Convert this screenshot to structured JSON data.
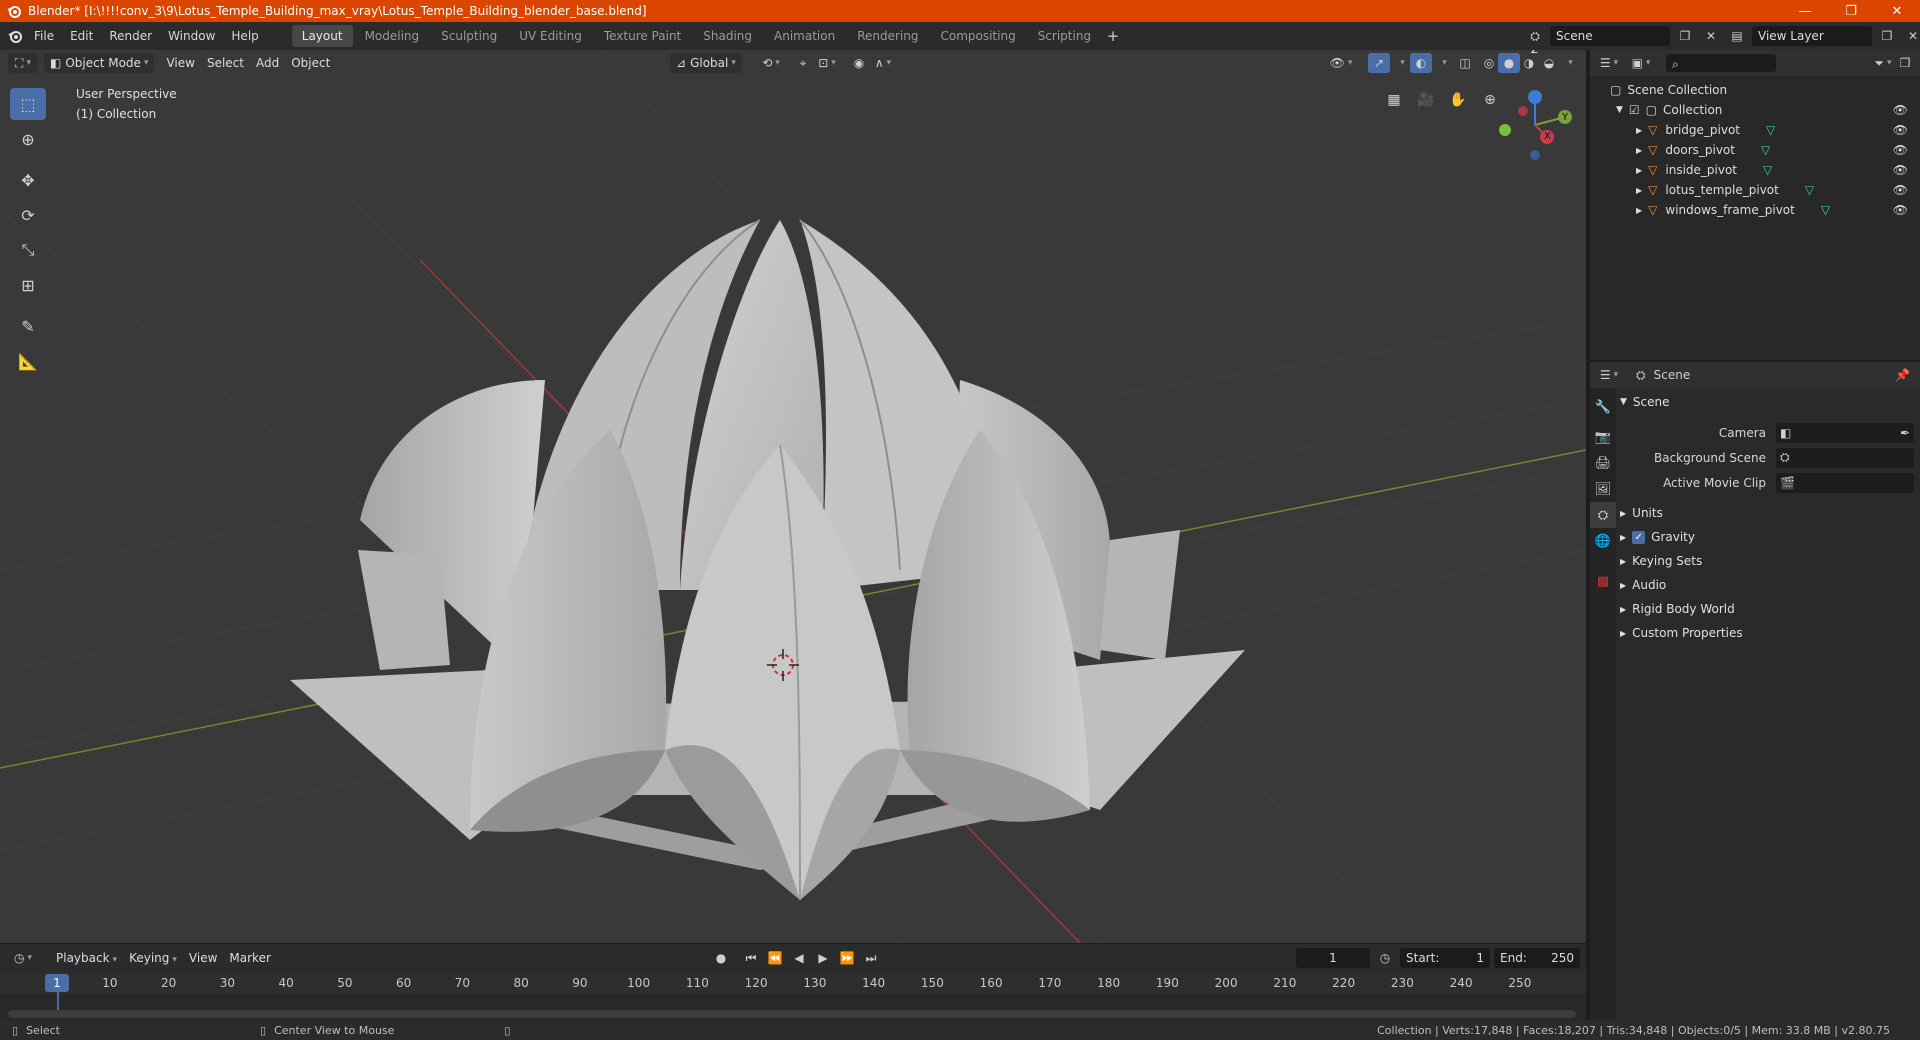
{
  "window": {
    "title": "Blender* [I:\\!!!!conv_3\\9\\Lotus_Temple_Building_max_vray\\Lotus_Temple_Building_blender_base.blend]",
    "minimize": "—",
    "restore": "❐",
    "close": "✕"
  },
  "menu": [
    "File",
    "Edit",
    "Render",
    "Window",
    "Help"
  ],
  "workspaces": [
    "Layout",
    "Modeling",
    "Sculpting",
    "UV Editing",
    "Texture Paint",
    "Shading",
    "Animation",
    "Rendering",
    "Compositing",
    "Scripting"
  ],
  "active_workspace": "Layout",
  "scene_field": "Scene",
  "view_layer_field": "View Layer",
  "viewport_header": {
    "mode": "Object Mode",
    "menus": [
      "View",
      "Select",
      "Add",
      "Object"
    ],
    "transform": "Global"
  },
  "viewport_info": {
    "line1": "User Perspective",
    "line2": "(1) Collection"
  },
  "gizmo": {
    "z": "Z",
    "y": "Y",
    "x": "X"
  },
  "outliner": {
    "root": "Scene Collection",
    "collection": "Collection",
    "items": [
      "bridge_pivot",
      "doors_pivot",
      "inside_pivot",
      "lotus_temple_pivot",
      "windows_frame_pivot"
    ]
  },
  "properties": {
    "context": "Scene",
    "panel": "Scene",
    "rows": [
      {
        "label": "Camera"
      },
      {
        "label": "Background Scene"
      },
      {
        "label": "Active Movie Clip"
      }
    ],
    "subpanels": [
      "Units",
      "Gravity",
      "Keying Sets",
      "Audio",
      "Rigid Body World",
      "Custom Properties"
    ]
  },
  "timeline": {
    "menus": [
      "Playback",
      "Keying",
      "View",
      "Marker"
    ],
    "current_frame": "1",
    "start_label": "Start:",
    "start": "1",
    "end_label": "End:",
    "end": "250",
    "ticks": [
      "1",
      "10",
      "20",
      "30",
      "40",
      "50",
      "60",
      "70",
      "80",
      "90",
      "100",
      "110",
      "120",
      "130",
      "140",
      "150",
      "160",
      "170",
      "180",
      "190",
      "200",
      "210",
      "220",
      "230",
      "240",
      "250"
    ]
  },
  "statusbar": {
    "select": "Select",
    "center_view": "Center View to Mouse",
    "stats": "Collection | Verts:17,848 | Faces:18,207 | Tris:34,848 | Objects:0/5 | Mem: 33.8 MB | v2.80.75"
  },
  "colors": {
    "titlebar": "#db4500",
    "accent": "#4a6ea8",
    "object_orange": "#e8913a",
    "mesh_green": "#3fc9a0"
  }
}
